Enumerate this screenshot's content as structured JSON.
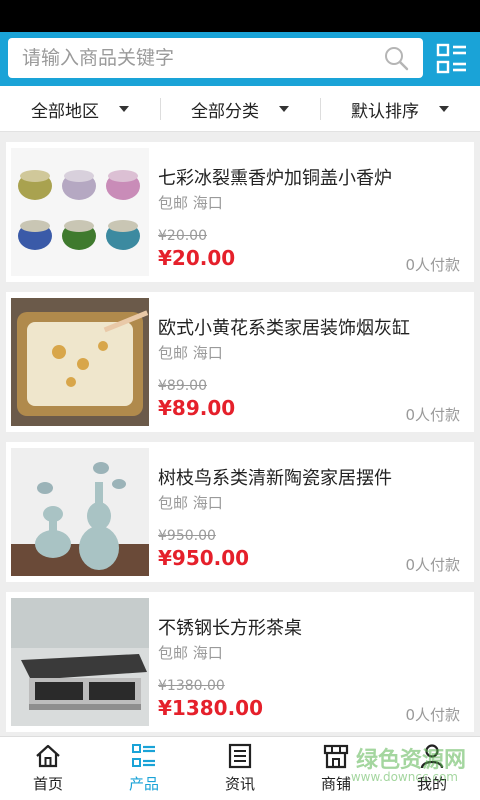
{
  "search": {
    "placeholder": "请输入商品关键字"
  },
  "filters": [
    {
      "label": "全部地区"
    },
    {
      "label": "全部分类"
    },
    {
      "label": "默认排序"
    }
  ],
  "products": [
    {
      "title": "七彩冰裂熏香炉加铜盖小香炉",
      "shipping": "包邮 海口",
      "old_price": "¥20.00",
      "price": "¥20.00",
      "sold": "0人付款"
    },
    {
      "title": "欧式小黄花系类家居装饰烟灰缸",
      "shipping": "包邮 海口",
      "old_price": "¥89.00",
      "price": "¥89.00",
      "sold": "0人付款"
    },
    {
      "title": "树枝鸟系类清新陶瓷家居摆件",
      "shipping": "包邮 海口",
      "old_price": "¥950.00",
      "price": "¥950.00",
      "sold": "0人付款"
    },
    {
      "title": "不锈钢长方形茶桌",
      "shipping": "包邮 海口",
      "old_price": "¥1380.00",
      "price": "¥1380.00",
      "sold": "0人付款"
    }
  ],
  "tabs": [
    {
      "label": "首页",
      "icon": "home-icon"
    },
    {
      "label": "产品",
      "icon": "product-list-icon",
      "active": true
    },
    {
      "label": "资讯",
      "icon": "news-icon"
    },
    {
      "label": "商铺",
      "icon": "store-icon"
    },
    {
      "label": "我的",
      "icon": "user-icon"
    }
  ],
  "watermark": {
    "text": "绿色资源网",
    "sub": "www.downcc.com"
  },
  "colors": {
    "accent": "#1aa3d7",
    "price": "#e5202b"
  }
}
